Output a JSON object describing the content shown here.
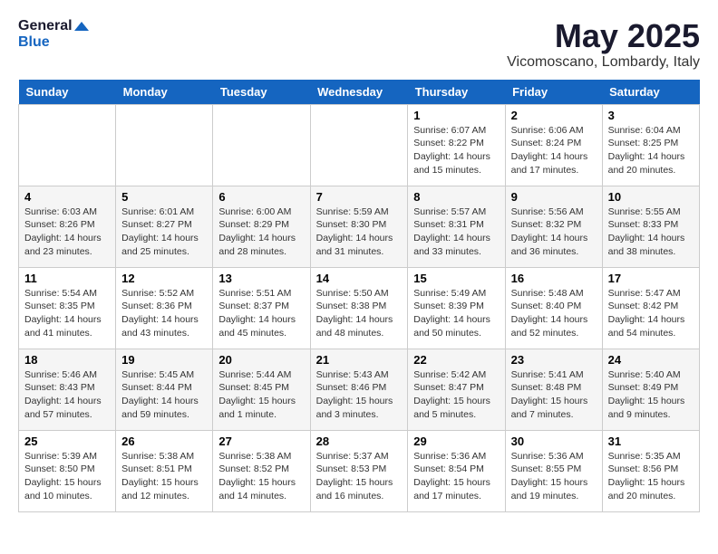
{
  "header": {
    "logo_line1": "General",
    "logo_line2": "Blue",
    "month_title": "May 2025",
    "location": "Vicomoscano, Lombardy, Italy"
  },
  "days_of_week": [
    "Sunday",
    "Monday",
    "Tuesday",
    "Wednesday",
    "Thursday",
    "Friday",
    "Saturday"
  ],
  "weeks": [
    [
      {
        "day": "",
        "info": ""
      },
      {
        "day": "",
        "info": ""
      },
      {
        "day": "",
        "info": ""
      },
      {
        "day": "",
        "info": ""
      },
      {
        "day": "1",
        "info": "Sunrise: 6:07 AM\nSunset: 8:22 PM\nDaylight: 14 hours\nand 15 minutes."
      },
      {
        "day": "2",
        "info": "Sunrise: 6:06 AM\nSunset: 8:24 PM\nDaylight: 14 hours\nand 17 minutes."
      },
      {
        "day": "3",
        "info": "Sunrise: 6:04 AM\nSunset: 8:25 PM\nDaylight: 14 hours\nand 20 minutes."
      }
    ],
    [
      {
        "day": "4",
        "info": "Sunrise: 6:03 AM\nSunset: 8:26 PM\nDaylight: 14 hours\nand 23 minutes."
      },
      {
        "day": "5",
        "info": "Sunrise: 6:01 AM\nSunset: 8:27 PM\nDaylight: 14 hours\nand 25 minutes."
      },
      {
        "day": "6",
        "info": "Sunrise: 6:00 AM\nSunset: 8:29 PM\nDaylight: 14 hours\nand 28 minutes."
      },
      {
        "day": "7",
        "info": "Sunrise: 5:59 AM\nSunset: 8:30 PM\nDaylight: 14 hours\nand 31 minutes."
      },
      {
        "day": "8",
        "info": "Sunrise: 5:57 AM\nSunset: 8:31 PM\nDaylight: 14 hours\nand 33 minutes."
      },
      {
        "day": "9",
        "info": "Sunrise: 5:56 AM\nSunset: 8:32 PM\nDaylight: 14 hours\nand 36 minutes."
      },
      {
        "day": "10",
        "info": "Sunrise: 5:55 AM\nSunset: 8:33 PM\nDaylight: 14 hours\nand 38 minutes."
      }
    ],
    [
      {
        "day": "11",
        "info": "Sunrise: 5:54 AM\nSunset: 8:35 PM\nDaylight: 14 hours\nand 41 minutes."
      },
      {
        "day": "12",
        "info": "Sunrise: 5:52 AM\nSunset: 8:36 PM\nDaylight: 14 hours\nand 43 minutes."
      },
      {
        "day": "13",
        "info": "Sunrise: 5:51 AM\nSunset: 8:37 PM\nDaylight: 14 hours\nand 45 minutes."
      },
      {
        "day": "14",
        "info": "Sunrise: 5:50 AM\nSunset: 8:38 PM\nDaylight: 14 hours\nand 48 minutes."
      },
      {
        "day": "15",
        "info": "Sunrise: 5:49 AM\nSunset: 8:39 PM\nDaylight: 14 hours\nand 50 minutes."
      },
      {
        "day": "16",
        "info": "Sunrise: 5:48 AM\nSunset: 8:40 PM\nDaylight: 14 hours\nand 52 minutes."
      },
      {
        "day": "17",
        "info": "Sunrise: 5:47 AM\nSunset: 8:42 PM\nDaylight: 14 hours\nand 54 minutes."
      }
    ],
    [
      {
        "day": "18",
        "info": "Sunrise: 5:46 AM\nSunset: 8:43 PM\nDaylight: 14 hours\nand 57 minutes."
      },
      {
        "day": "19",
        "info": "Sunrise: 5:45 AM\nSunset: 8:44 PM\nDaylight: 14 hours\nand 59 minutes."
      },
      {
        "day": "20",
        "info": "Sunrise: 5:44 AM\nSunset: 8:45 PM\nDaylight: 15 hours\nand 1 minute."
      },
      {
        "day": "21",
        "info": "Sunrise: 5:43 AM\nSunset: 8:46 PM\nDaylight: 15 hours\nand 3 minutes."
      },
      {
        "day": "22",
        "info": "Sunrise: 5:42 AM\nSunset: 8:47 PM\nDaylight: 15 hours\nand 5 minutes."
      },
      {
        "day": "23",
        "info": "Sunrise: 5:41 AM\nSunset: 8:48 PM\nDaylight: 15 hours\nand 7 minutes."
      },
      {
        "day": "24",
        "info": "Sunrise: 5:40 AM\nSunset: 8:49 PM\nDaylight: 15 hours\nand 9 minutes."
      }
    ],
    [
      {
        "day": "25",
        "info": "Sunrise: 5:39 AM\nSunset: 8:50 PM\nDaylight: 15 hours\nand 10 minutes."
      },
      {
        "day": "26",
        "info": "Sunrise: 5:38 AM\nSunset: 8:51 PM\nDaylight: 15 hours\nand 12 minutes."
      },
      {
        "day": "27",
        "info": "Sunrise: 5:38 AM\nSunset: 8:52 PM\nDaylight: 15 hours\nand 14 minutes."
      },
      {
        "day": "28",
        "info": "Sunrise: 5:37 AM\nSunset: 8:53 PM\nDaylight: 15 hours\nand 16 minutes."
      },
      {
        "day": "29",
        "info": "Sunrise: 5:36 AM\nSunset: 8:54 PM\nDaylight: 15 hours\nand 17 minutes."
      },
      {
        "day": "30",
        "info": "Sunrise: 5:36 AM\nSunset: 8:55 PM\nDaylight: 15 hours\nand 19 minutes."
      },
      {
        "day": "31",
        "info": "Sunrise: 5:35 AM\nSunset: 8:56 PM\nDaylight: 15 hours\nand 20 minutes."
      }
    ]
  ]
}
